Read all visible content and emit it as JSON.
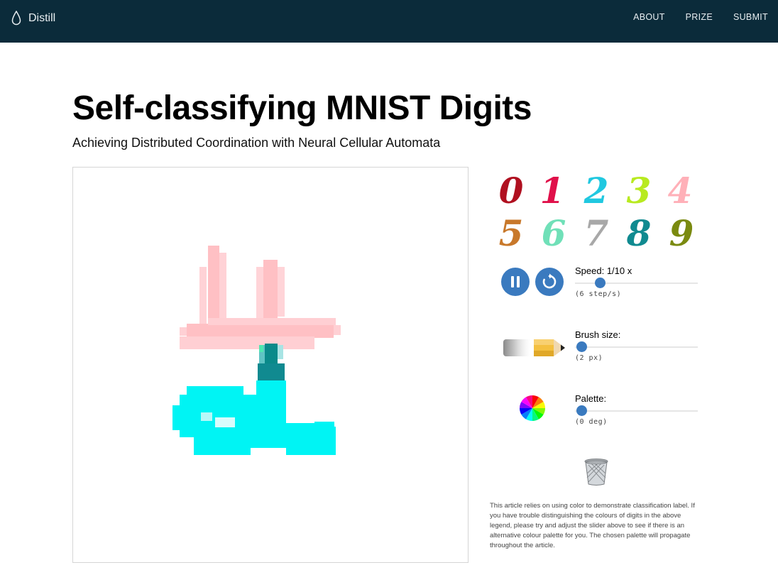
{
  "header": {
    "brand": "Distill",
    "nav": [
      "ABOUT",
      "PRIZE",
      "SUBMIT"
    ]
  },
  "article": {
    "title": "Self-classifying MNIST Digits",
    "subtitle": "Achieving Distributed Coordination with Neural Cellular Automata"
  },
  "legend": {
    "digits": [
      "0",
      "1",
      "2",
      "3",
      "4",
      "5",
      "6",
      "7",
      "8",
      "9"
    ],
    "colors": [
      "#b01020",
      "#e0104a",
      "#20c8e0",
      "#b8ea20",
      "#ffb0b8",
      "#c8782a",
      "#70e0b8",
      "#a8a8a8",
      "#108a90",
      "#7a8a10"
    ]
  },
  "controls": {
    "speed": {
      "label": "Speed: 1/10 x",
      "value_text": "(6 step/s)",
      "fraction": 0.2
    },
    "brush": {
      "label": "Brush size:",
      "value_text": "(2 px)",
      "fraction": 0.05
    },
    "palette": {
      "label": "Palette:",
      "value_text": "(0 deg)",
      "fraction": 0.05
    }
  },
  "note": "This article relies on using color to demonstrate classification label. If you have trouble distinguishing the colours of digits in the above legend, please try and adjust the slider above to see if there is an alternative colour palette for you. The chosen palette will propagate throughout the article.",
  "icons": {
    "brand": "droplet-icon",
    "pause": "pause-icon",
    "reset": "reset-icon",
    "brush": "pencil-icon",
    "palette": "color-wheel-icon",
    "trash": "trash-icon"
  }
}
